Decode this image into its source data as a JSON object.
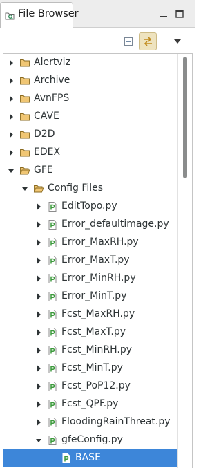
{
  "view": {
    "tab_label": "File Browser",
    "tab_icon": "file-browser-icon"
  },
  "window_controls": {
    "minimize_icon": "minimize-icon",
    "maximize_icon": "maximize-icon"
  },
  "toolbar": {
    "collapse_icon": "collapse-all-icon",
    "link_icon": "link-with-editor-icon",
    "link_active": true,
    "menu_icon": "view-menu-icon"
  },
  "tree": {
    "items": [
      {
        "label": "Alertviz",
        "type": "folder",
        "level": 0,
        "expanded": false
      },
      {
        "label": "Archive",
        "type": "folder",
        "level": 0,
        "expanded": false
      },
      {
        "label": "AvnFPS",
        "type": "folder",
        "level": 0,
        "expanded": false
      },
      {
        "label": "CAVE",
        "type": "folder",
        "level": 0,
        "expanded": false
      },
      {
        "label": "D2D",
        "type": "folder",
        "level": 0,
        "expanded": false
      },
      {
        "label": "EDEX",
        "type": "folder",
        "level": 0,
        "expanded": false
      },
      {
        "label": "GFE",
        "type": "folder",
        "level": 0,
        "expanded": true
      },
      {
        "label": "Config Files",
        "type": "folder",
        "level": 1,
        "expanded": true
      },
      {
        "label": "EditTopo.py",
        "type": "file",
        "level": 2,
        "expanded": false
      },
      {
        "label": "Error_defaultimage.py",
        "type": "file",
        "level": 2,
        "expanded": false
      },
      {
        "label": "Error_MaxRH.py",
        "type": "file",
        "level": 2,
        "expanded": false
      },
      {
        "label": "Error_MaxT.py",
        "type": "file",
        "level": 2,
        "expanded": false
      },
      {
        "label": "Error_MinRH.py",
        "type": "file",
        "level": 2,
        "expanded": false
      },
      {
        "label": "Error_MinT.py",
        "type": "file",
        "level": 2,
        "expanded": false
      },
      {
        "label": "Fcst_MaxRH.py",
        "type": "file",
        "level": 2,
        "expanded": false
      },
      {
        "label": "Fcst_MaxT.py",
        "type": "file",
        "level": 2,
        "expanded": false
      },
      {
        "label": "Fcst_MinRH.py",
        "type": "file",
        "level": 2,
        "expanded": false
      },
      {
        "label": "Fcst_MinT.py",
        "type": "file",
        "level": 2,
        "expanded": false
      },
      {
        "label": "Fcst_PoP12.py",
        "type": "file",
        "level": 2,
        "expanded": false
      },
      {
        "label": "Fcst_QPF.py",
        "type": "file",
        "level": 2,
        "expanded": false
      },
      {
        "label": "FloodingRainThreat.py",
        "type": "file",
        "level": 2,
        "expanded": false
      },
      {
        "label": "gfeConfig.py",
        "type": "file",
        "level": 2,
        "expanded": true
      },
      {
        "label": "BASE",
        "type": "file",
        "level": 3,
        "leaf": true,
        "selected": true
      }
    ]
  },
  "colors": {
    "selection": "#3d86d9",
    "folder": "#f0c674",
    "file_icon": "#3c9a3c",
    "scroll_thumb": "#8a8c8c"
  }
}
